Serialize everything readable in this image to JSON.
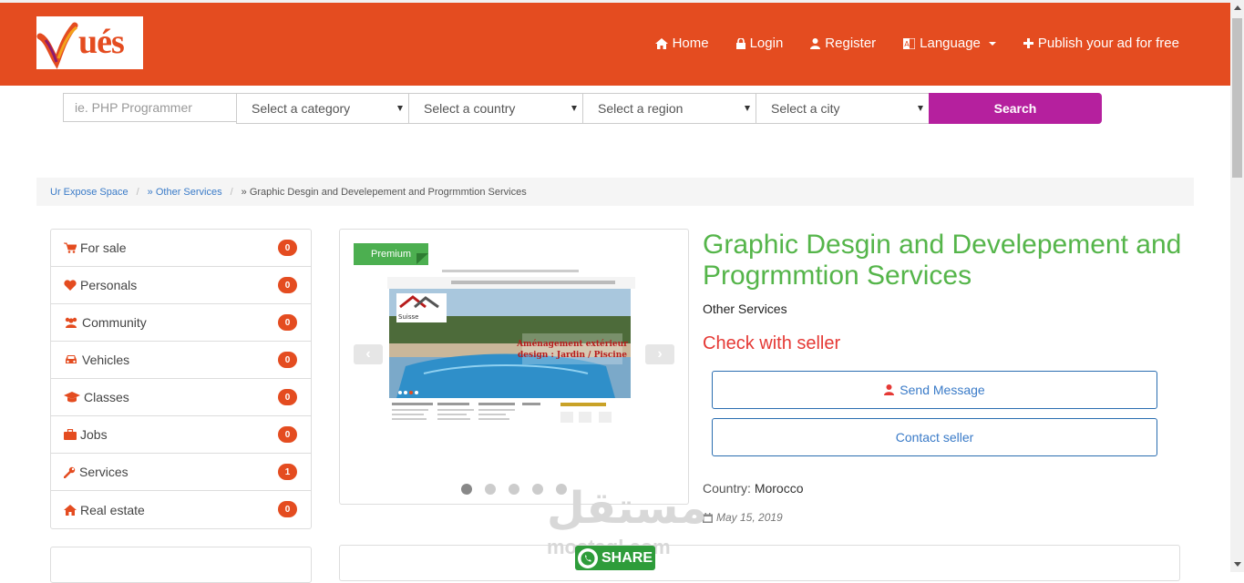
{
  "brand": {
    "logo_text": "ués"
  },
  "nav": {
    "home": "Home",
    "login": "Login",
    "register": "Register",
    "language": "Language",
    "publish": "Publish your ad for free"
  },
  "search": {
    "placeholder": "ie. PHP Programmer",
    "category": "Select a category",
    "country": "Select a country",
    "region": "Select a region",
    "city": "Select a city",
    "button": "Search"
  },
  "breadcrumb": {
    "root": "Ur Expose Space",
    "parent": "» Other Services",
    "current": "» Graphic Desgin and Develepement and Progrmmtion Services"
  },
  "categories": [
    {
      "label": "For sale",
      "count": "0",
      "icon": "cart-icon"
    },
    {
      "label": "Personals",
      "count": "0",
      "icon": "heart-icon"
    },
    {
      "label": "Community",
      "count": "0",
      "icon": "users-icon"
    },
    {
      "label": "Vehicles",
      "count": "0",
      "icon": "car-icon"
    },
    {
      "label": "Classes",
      "count": "0",
      "icon": "graduation-cap-icon"
    },
    {
      "label": "Jobs",
      "count": "0",
      "icon": "briefcase-icon"
    },
    {
      "label": "Services",
      "count": "1",
      "icon": "wrench-icon"
    },
    {
      "label": "Real estate",
      "count": "0",
      "icon": "home-icon"
    }
  ],
  "listing": {
    "badge": "Premium",
    "title": "Graphic Desgin and Develepement and Progrmmtion Services",
    "category": "Other Services",
    "price": "Check with seller",
    "send_message": "Send Message",
    "contact_seller": "Contact seller",
    "country_label": "Country:",
    "country": "Morocco",
    "date": "May 15, 2019",
    "slides": 5,
    "active_slide": 1
  },
  "preview_image": {
    "overlay_line1": "Aménagement extérieur",
    "overlay_line2": "design : Jardin / Piscine",
    "brand": "Suisse"
  },
  "watermark": {
    "text": "مستقل",
    "sub": "mostaql.com"
  },
  "share": {
    "label": "SHARE"
  },
  "colors": {
    "header": "#e44c20",
    "search_button": "#b5209e",
    "title_green": "#55b54a",
    "price_red": "#e53935",
    "link_blue": "#3a7bc8"
  }
}
